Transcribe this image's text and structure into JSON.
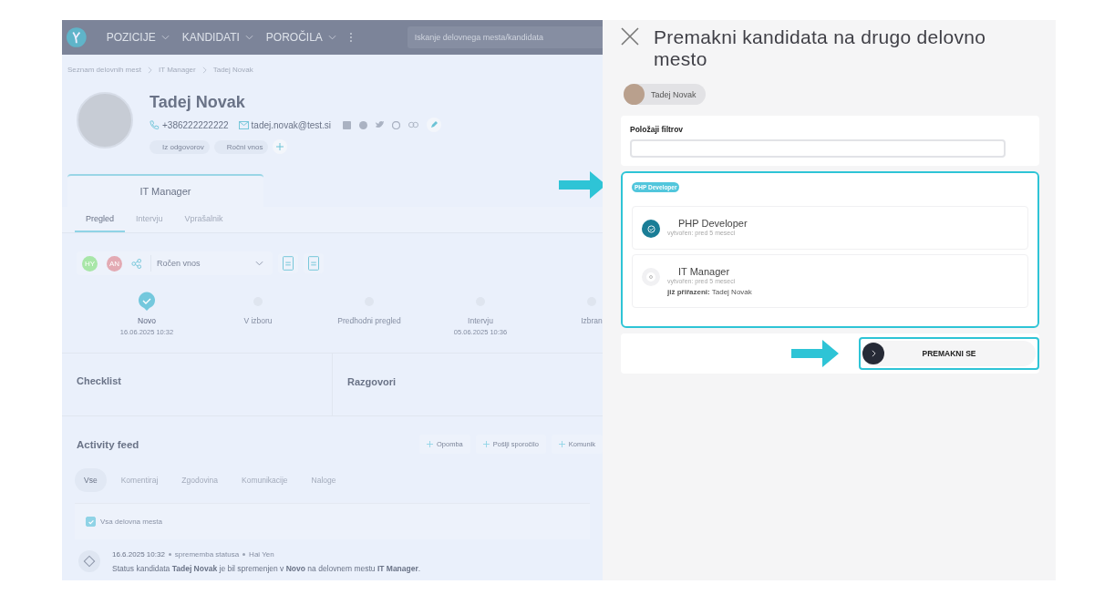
{
  "nav": {
    "items": [
      {
        "label": "POZICIJE"
      },
      {
        "label": "KANDIDATI"
      },
      {
        "label": "POROČILA"
      }
    ],
    "search": {
      "placeholder": "Iskanje delovnega mesta/kandidata"
    }
  },
  "breadcrumb": [
    "Seznam delovnih mest",
    "IT Manager",
    "Tadej Novak"
  ],
  "candidate": {
    "name": "Tadej Novak",
    "phone": "+386222222222",
    "email": "tadej.novak@test.si",
    "tags": [
      "Iz odgovorov",
      "Ročni vnos"
    ]
  },
  "job_tab": {
    "label": "IT Manager"
  },
  "subtabs": [
    {
      "label": "Pregled",
      "selected": true
    },
    {
      "label": "Intervju",
      "selected": false
    },
    {
      "label": "Vprašalnik",
      "selected": false
    }
  ],
  "toolbar": {
    "avatars": [
      {
        "initials": "HY",
        "color": "#a8e6a8"
      },
      {
        "initials": "AN",
        "color": "#e3aab3"
      }
    ],
    "source": "Ročen vnos"
  },
  "stages": [
    {
      "label": "Novo",
      "date": "16.06.2025 10:32",
      "done": true
    },
    {
      "label": "V izboru",
      "done": false
    },
    {
      "label": "Predhodni pregled",
      "done": false
    },
    {
      "label": "Intervju",
      "date": "05.06.2025 10:36",
      "done": false
    },
    {
      "label": "Izbran",
      "done": false
    }
  ],
  "sections": [
    "Checklist",
    "Razgovori"
  ],
  "activity": {
    "title": "Activity feed",
    "buttons": [
      "Opomba",
      "Pošlji sporočilo",
      "Komunik"
    ],
    "filters": [
      {
        "label": "Vse",
        "selected": true
      },
      {
        "label": "Komentiraj",
        "selected": false
      },
      {
        "label": "Zgodovina",
        "selected": false
      },
      {
        "label": "Komunikacije",
        "selected": false
      },
      {
        "label": "Naloge",
        "selected": false
      }
    ],
    "all_jobs": {
      "label": "Vsa delovna mesta",
      "checked": true
    },
    "entry": {
      "date": "16.6.2025 10:32",
      "type": "sprememba statusa",
      "author": "Hai Yen",
      "text": "Status kandidata **Tadej Novak** je bil spremenjen v **Novo** na delovnem mestu **IT Manager**."
    }
  },
  "panel": {
    "title": "Premakni kandidata na drugo delovno mesto",
    "candidate": "Tadej Novak",
    "filter_label": "Položaji filtrov",
    "group": "PHP Developer",
    "options": [
      {
        "title": "PHP Developer",
        "created": "vytvořen: pred 5 meseci",
        "selected": true
      },
      {
        "title": "IT Manager",
        "created": "vytvořen: pred 5 meseci",
        "assigned": "**již přiřazeni:** Tadej Novak",
        "selected": false
      }
    ],
    "button": "PREMAKNI SE"
  }
}
